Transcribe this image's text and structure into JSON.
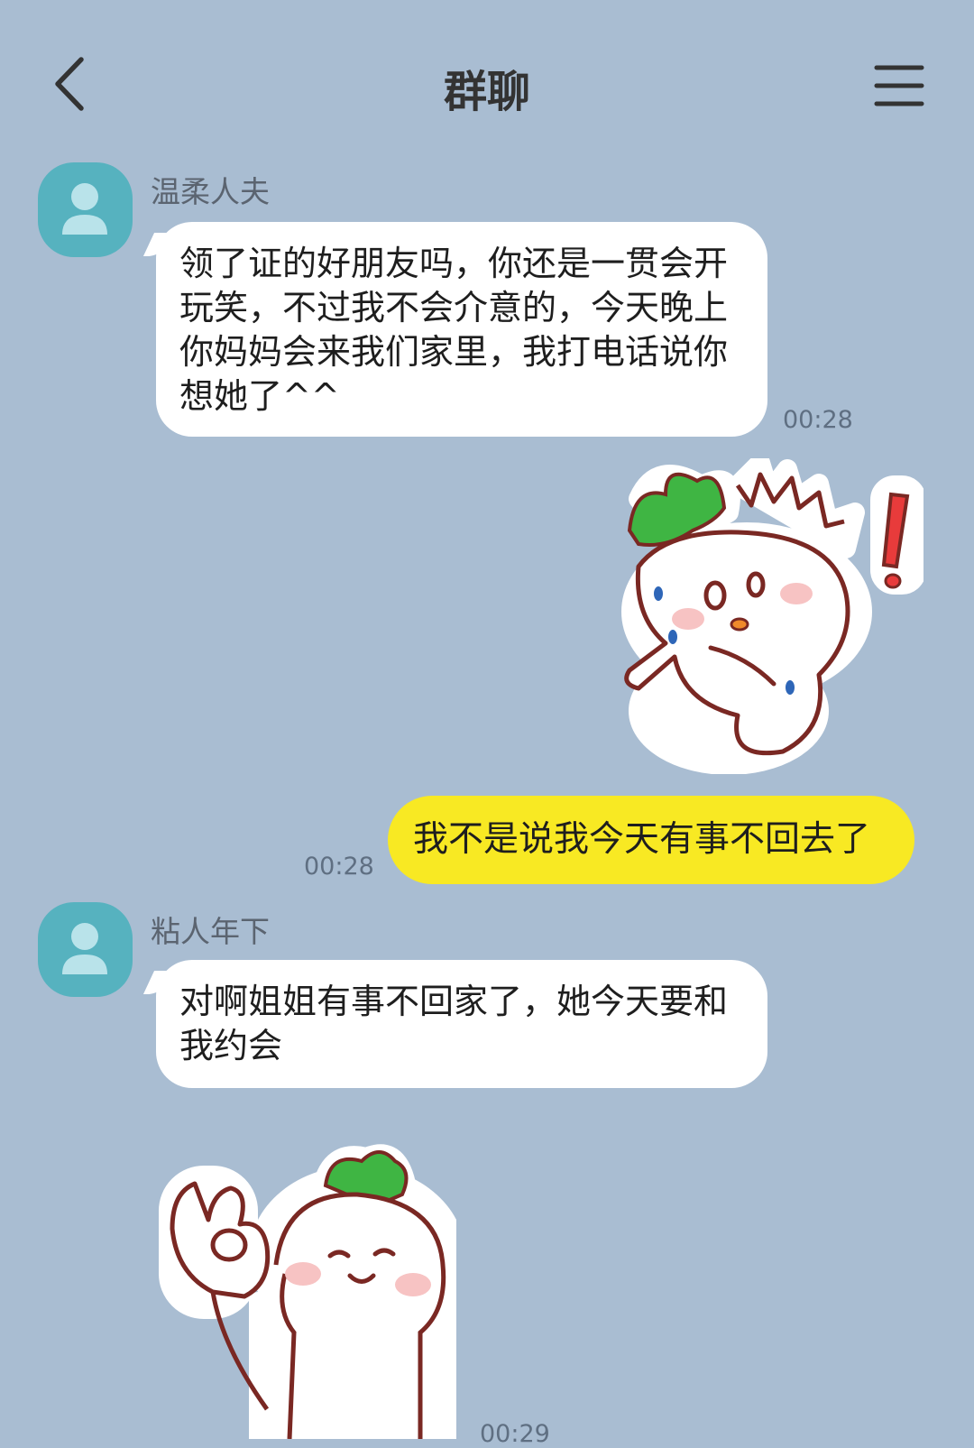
{
  "header": {
    "title": "群聊",
    "back_icon": "chevron-left-icon",
    "menu_icon": "hamburger-menu-icon"
  },
  "messages": [
    {
      "sender": "温柔人夫",
      "text": "领了证的好朋友吗，你还是一贯会开玩笑，不过我不会介意的，今天晚上你妈妈会来我们家里，我打电话说你想她了^^",
      "time": "00:28"
    },
    {
      "sticker": "surprised-radish-sticker"
    },
    {
      "text": "我不是说我今天有事不回去了",
      "time": "00:28",
      "outgoing": true
    },
    {
      "sender": "粘人年下",
      "text": "对啊姐姐有事不回家了，她今天要和我约会"
    },
    {
      "sticker": "ok-gesture-radish-sticker",
      "time": "00:29"
    }
  ],
  "colors": {
    "background": "#a9bdd2",
    "outgoing_bubble": "#f8e923",
    "incoming_bubble": "#ffffff",
    "avatar": "#56b2bf"
  }
}
